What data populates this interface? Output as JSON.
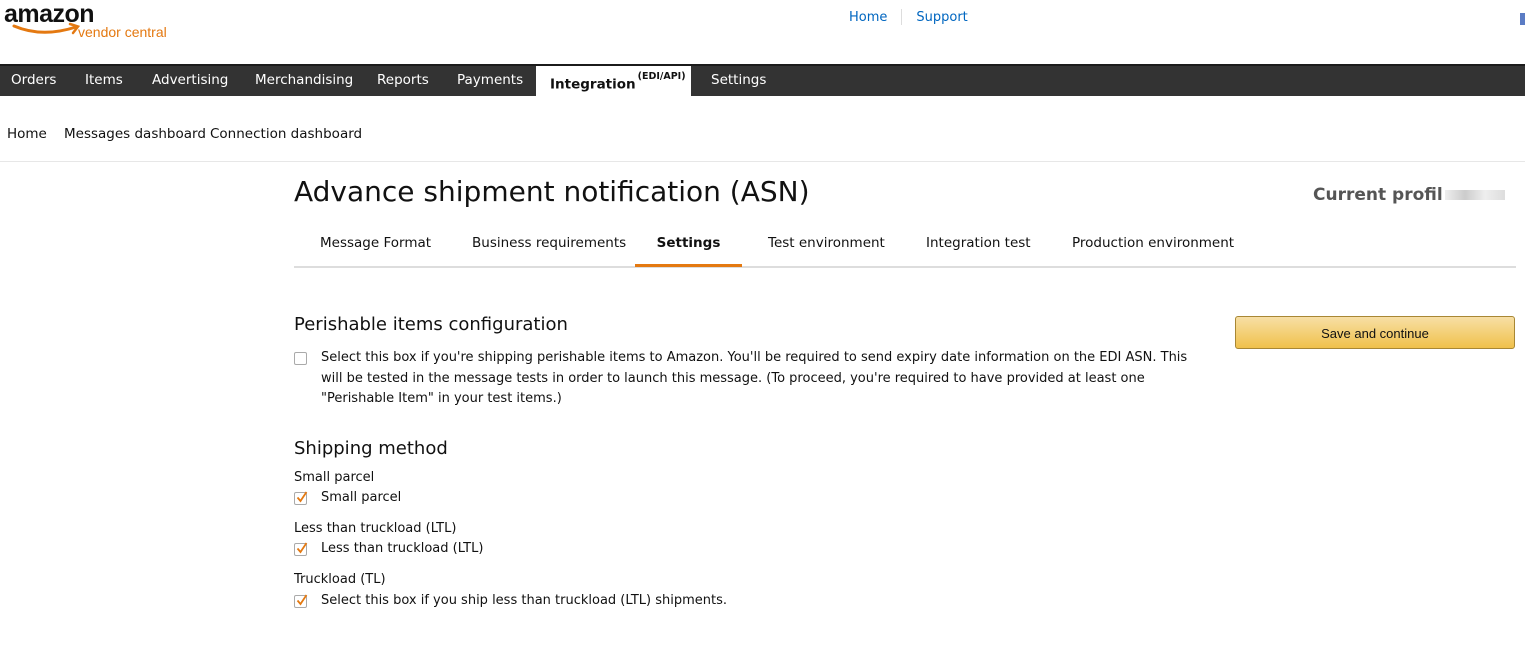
{
  "header": {
    "logo_text": "amazon",
    "logo_sub": "vendor central",
    "links": [
      "Home",
      "Support"
    ],
    "accent_color": "#e47911",
    "link_color": "#0066c0"
  },
  "nav": {
    "items": [
      "Orders",
      "Items",
      "Advertising",
      "Merchandising",
      "Reports",
      "Payments",
      "Integration",
      "Settings"
    ],
    "active_sup": "(EDI/API)",
    "active_index": 6
  },
  "subnav": [
    "Home",
    "Messages dashboard",
    "Connection dashboard"
  ],
  "page": {
    "title": "Advance shipment notification (ASN)",
    "profile_label": "Current profil"
  },
  "tabs": {
    "items": [
      "Message Format",
      "Business requirements",
      "Settings",
      "Test environment",
      "Integration test",
      "Production environment"
    ],
    "active_index": 2
  },
  "perishable": {
    "heading": "Perishable items configuration",
    "checkbox_checked": false,
    "text_before": "Select this box if you're shipping perishable items to Amazon. You'll be required to send expiry date information on the ",
    "text_bold": "EDI",
    "text_after": " ASN. This will be tested in the message tests in order to launch this message. (To proceed, you're required to have provided at least one \"Perishable Item\" in your test items.)"
  },
  "shipping": {
    "heading": "Shipping method",
    "options": [
      {
        "label": "Small parcel",
        "checkbox_label": "Small parcel",
        "checked": true
      },
      {
        "label": "Less than truckload (LTL)",
        "checkbox_label": "Less than truckload (LTL)",
        "checked": true
      },
      {
        "label": "Truckload (TL)",
        "checkbox_label": "Select this box if you ship less than truckload (LTL) shipments.",
        "checked": true
      }
    ]
  },
  "actions": {
    "save_label": "Save and continue",
    "button_color": "#f0c14b"
  }
}
